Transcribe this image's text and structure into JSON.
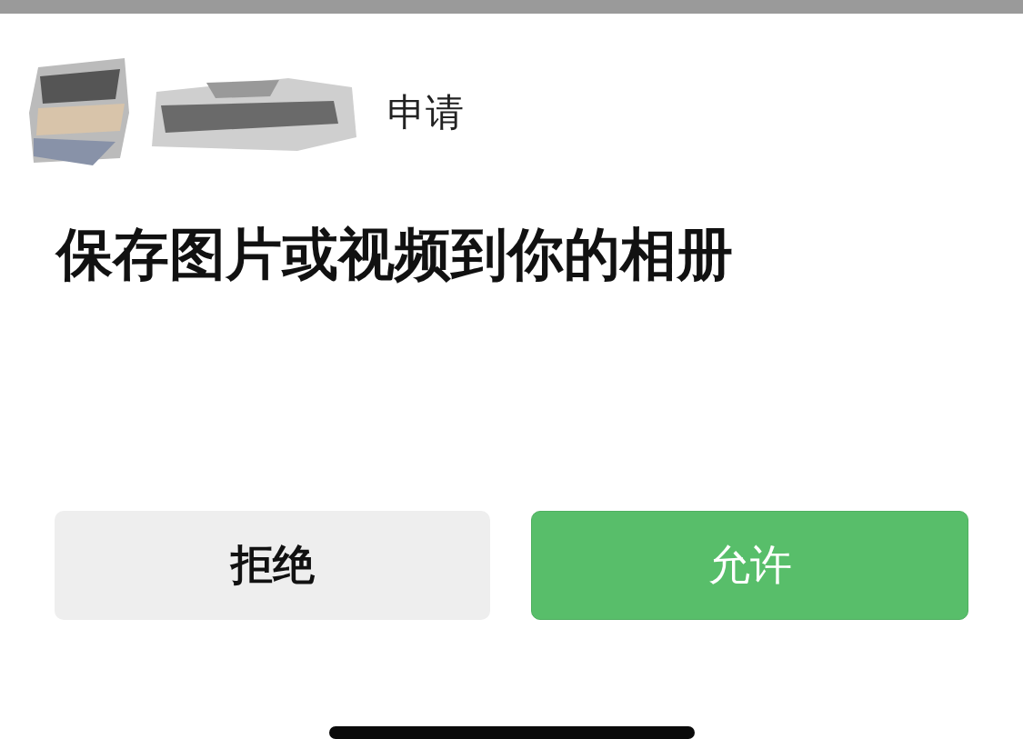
{
  "header": {
    "action": "申请"
  },
  "title": "保存图片或视频到你的相册",
  "buttons": [
    {
      "label": "拒绝",
      "kind": "secondary"
    },
    {
      "label": "允许",
      "kind": "primary"
    }
  ]
}
